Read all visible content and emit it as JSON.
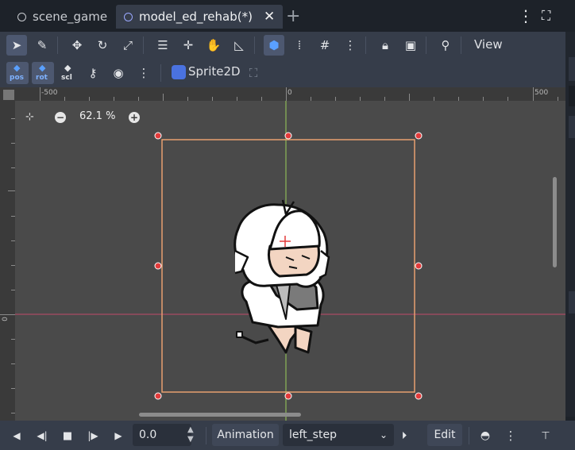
{
  "tabs": [
    {
      "label": "scene_game",
      "active": false
    },
    {
      "label": "model_ed_rehab(*)",
      "active": true
    }
  ],
  "toolbar": {
    "view_label": "View",
    "key_buttons": [
      "pos",
      "rot",
      "scl"
    ],
    "sprite_label": "Sprite2D"
  },
  "viewport": {
    "zoom": "62.1 %",
    "ruler_top": [
      "-500",
      "0",
      "500"
    ],
    "ruler_left": [
      "0"
    ]
  },
  "animation_bar": {
    "time_value": "0.0",
    "animation_label": "Animation",
    "animation_selected": "left_step",
    "edit_label": "Edit"
  },
  "colors": {
    "bg_dark": "#1d2229",
    "panel": "#363d4a",
    "viewport": "#4a4a4a",
    "selection_box": "#e8a070",
    "handle": "#e23b3b",
    "accent": "#5aa0ff"
  }
}
